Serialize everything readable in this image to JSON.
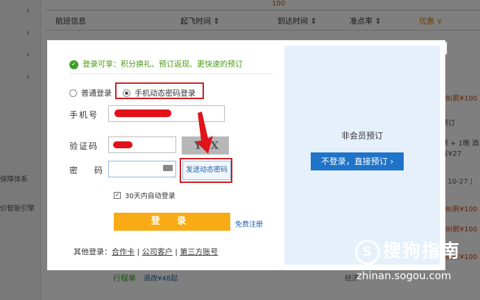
{
  "background": {
    "columns": [
      "航班信息",
      "起飞时间 ⇕",
      "到达时间 ⇕",
      "准点率 ⇕",
      "优惠 ∨"
    ],
    "sidebar": [
      "保障体系",
      "价智能引擎"
    ],
    "right_snippets": [
      "-¥28(航¥100有",
      "通预订",
      "机票 + 1晚 酒店",
      "已省¥27",
      "1间 10-27 ¦ 10",
      "-¥28(航¥100有",
      "-¥28(航¥100有",
      "-¥28(航¥100有"
    ],
    "bottom_left": "行程单",
    "bottom_mid": "退改¥48起",
    "bottom_right": "经济",
    "tab_value": "100"
  },
  "dialog": {
    "success_text": "登录可享：积分换礼、预订返现、更快速的预订",
    "radio_normal": "普通登录",
    "radio_dynamic": "手机动态密码登录",
    "phone_label": "手机号",
    "captcha_label": "验证码",
    "password_label": "密 码",
    "captcha_text": "YSX",
    "send_code": "发送动态密码",
    "auto_login": "30天内自动登录",
    "login_button": "登 录",
    "register_link": "免费注册",
    "other_login_label": "其他登录：",
    "other_links": [
      "合作卡",
      "公司客户",
      "第三方账号"
    ],
    "close": "×"
  },
  "guest": {
    "title": "非会员预订",
    "button": "不登录，直接预订 ›"
  },
  "watermark": {
    "logo": "S",
    "brand": "搜狗指南",
    "url": "zhinan.sogou.com"
  },
  "colors": {
    "accent_red": "#d0181b",
    "login_orange": "#f9ab16",
    "guest_blue": "#1f73c9",
    "success_green": "#3a9d23"
  }
}
